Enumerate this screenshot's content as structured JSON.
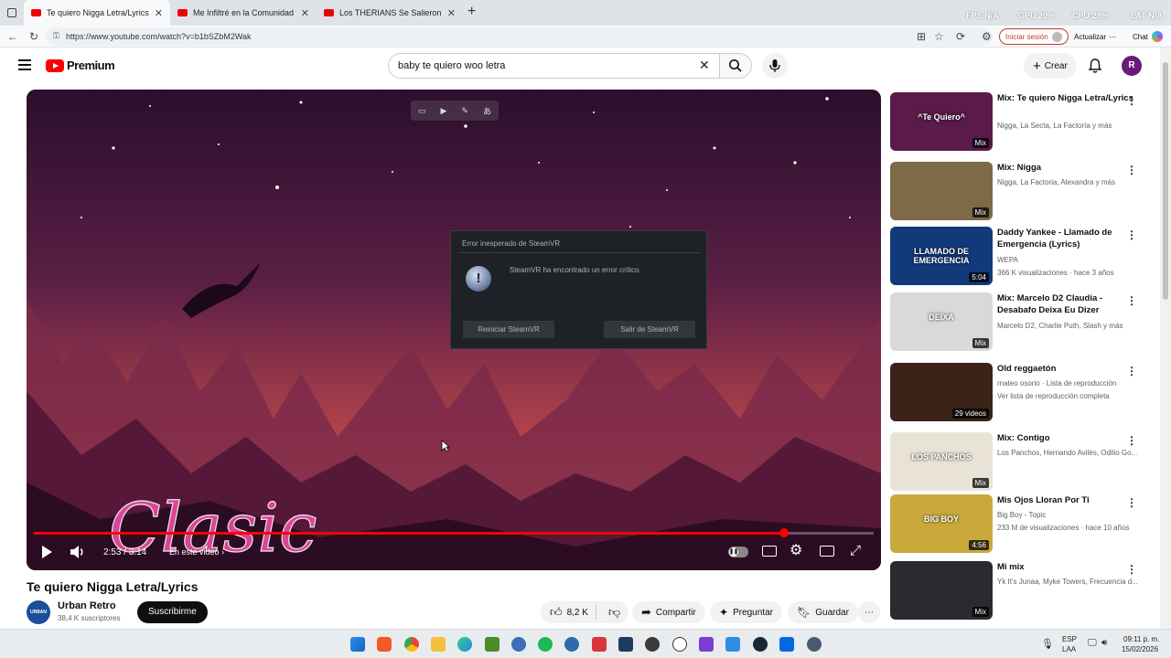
{
  "browser": {
    "tabs": [
      {
        "title": "Te quiero Nigga Letra/Lyrics - YouT",
        "active": true
      },
      {
        "title": "Me Infiltré en la Comunidad Therian",
        "active": false
      },
      {
        "title": "Los THERIANS Se Salieron De Cont",
        "active": false
      }
    ],
    "stats": {
      "fps": "FPS N/A",
      "gpu": "GPU 20%",
      "cpu": "CPU 28%",
      "lat": "LAT N/A"
    },
    "url": "https://www.youtube.com/watch?v=b1bSZbM2Wak",
    "signin_label": "Iniciar sesión",
    "update_label": "Actualizar",
    "chat_label": "Chat"
  },
  "youtube": {
    "logo_text": "Premium",
    "search_value": "baby te quiero woo letra",
    "create_label": "Crear",
    "avatar_letter": "R"
  },
  "player": {
    "time": "2:53 / 3:14",
    "chapter": "En este video",
    "progress": 0.893,
    "watermark": "Clasic"
  },
  "dialog": {
    "title": "Error inesperado de SteamVR",
    "message": "SteamVR ha encontrado un error crítico.",
    "restart_label": "Reiniciar SteamVR",
    "exit_label": "Salir de SteamVR"
  },
  "video": {
    "title": "Te quiero Nigga Letra/Lyrics",
    "channel": "Urban Retro",
    "channel_avatar_text": "URBAN RETRO",
    "subscribers": "38,4 K suscriptores",
    "subscribe_label": "Suscribirme",
    "likes": "8,2 K",
    "share_label": "Compartir",
    "ask_label": "Preguntar",
    "save_label": "Guardar"
  },
  "sidebar": {
    "items": [
      {
        "title": "Mix: Te quiero Nigga Letra/Lyrics",
        "line1": "Nigga, La Secta, La Factoría y más",
        "line2": "",
        "badge": "Mix",
        "thumb_text": "^Te Quiero^",
        "color": "#5a1a4a"
      },
      {
        "title": "Mix: Nigga",
        "line1": "Nigga, La Factoria, Alexandra y más",
        "line2": "",
        "badge": "Mix",
        "thumb_text": "",
        "color": "#7d6a48"
      },
      {
        "title": "Daddy Yankee - Llamado de Emergencia (Lyrics)",
        "line1": "WEPA",
        "line2": "366 K visualizaciones · hace 3 años",
        "badge": "5:04",
        "thumb_text": "LLAMADO DE EMERGENCIA",
        "color": "#123a7a"
      },
      {
        "title": "Mix: Marcelo D2 Claudia - Desabafo Deixa Eu Dizer",
        "line1": "Marcelo D2, Charlie Puth, Slash y más",
        "line2": "",
        "badge": "Mix",
        "thumb_text": "DEIXA",
        "color": "#d9d9d9"
      },
      {
        "title": "Old reggaetón",
        "line1": "rnateo osorio · Lista de reproducción",
        "line2": "Ver lista de reproducción completa",
        "badge": "29 videos",
        "thumb_text": "",
        "color": "#3a2418"
      },
      {
        "title": "Mix: Contigo",
        "line1": "Los Panchos, Hernando Avilés, Odilio Go...",
        "line2": "",
        "badge": "Mix",
        "thumb_text": "LOS PANCHOS",
        "color": "#e8e3d6"
      },
      {
        "title": "Mis Ojos Lloran Por Ti",
        "line1": "Big Boy - Topic",
        "line2": "233 M de visualizaciones · hace 10 años",
        "badge": "4:56",
        "thumb_text": "BIG BOY",
        "color": "#c9a93b"
      },
      {
        "title": "Mi mix",
        "line1": "Yk It's Junaa, Myke Towers, Frecuencia d...",
        "line2": "",
        "badge": "Mix",
        "thumb_text": "",
        "color": "#2a2a30"
      }
    ]
  },
  "taskbar": {
    "lang": "ESP",
    "region": "LAA",
    "time": "09:11 p. m.",
    "date": "15/02/2026"
  }
}
